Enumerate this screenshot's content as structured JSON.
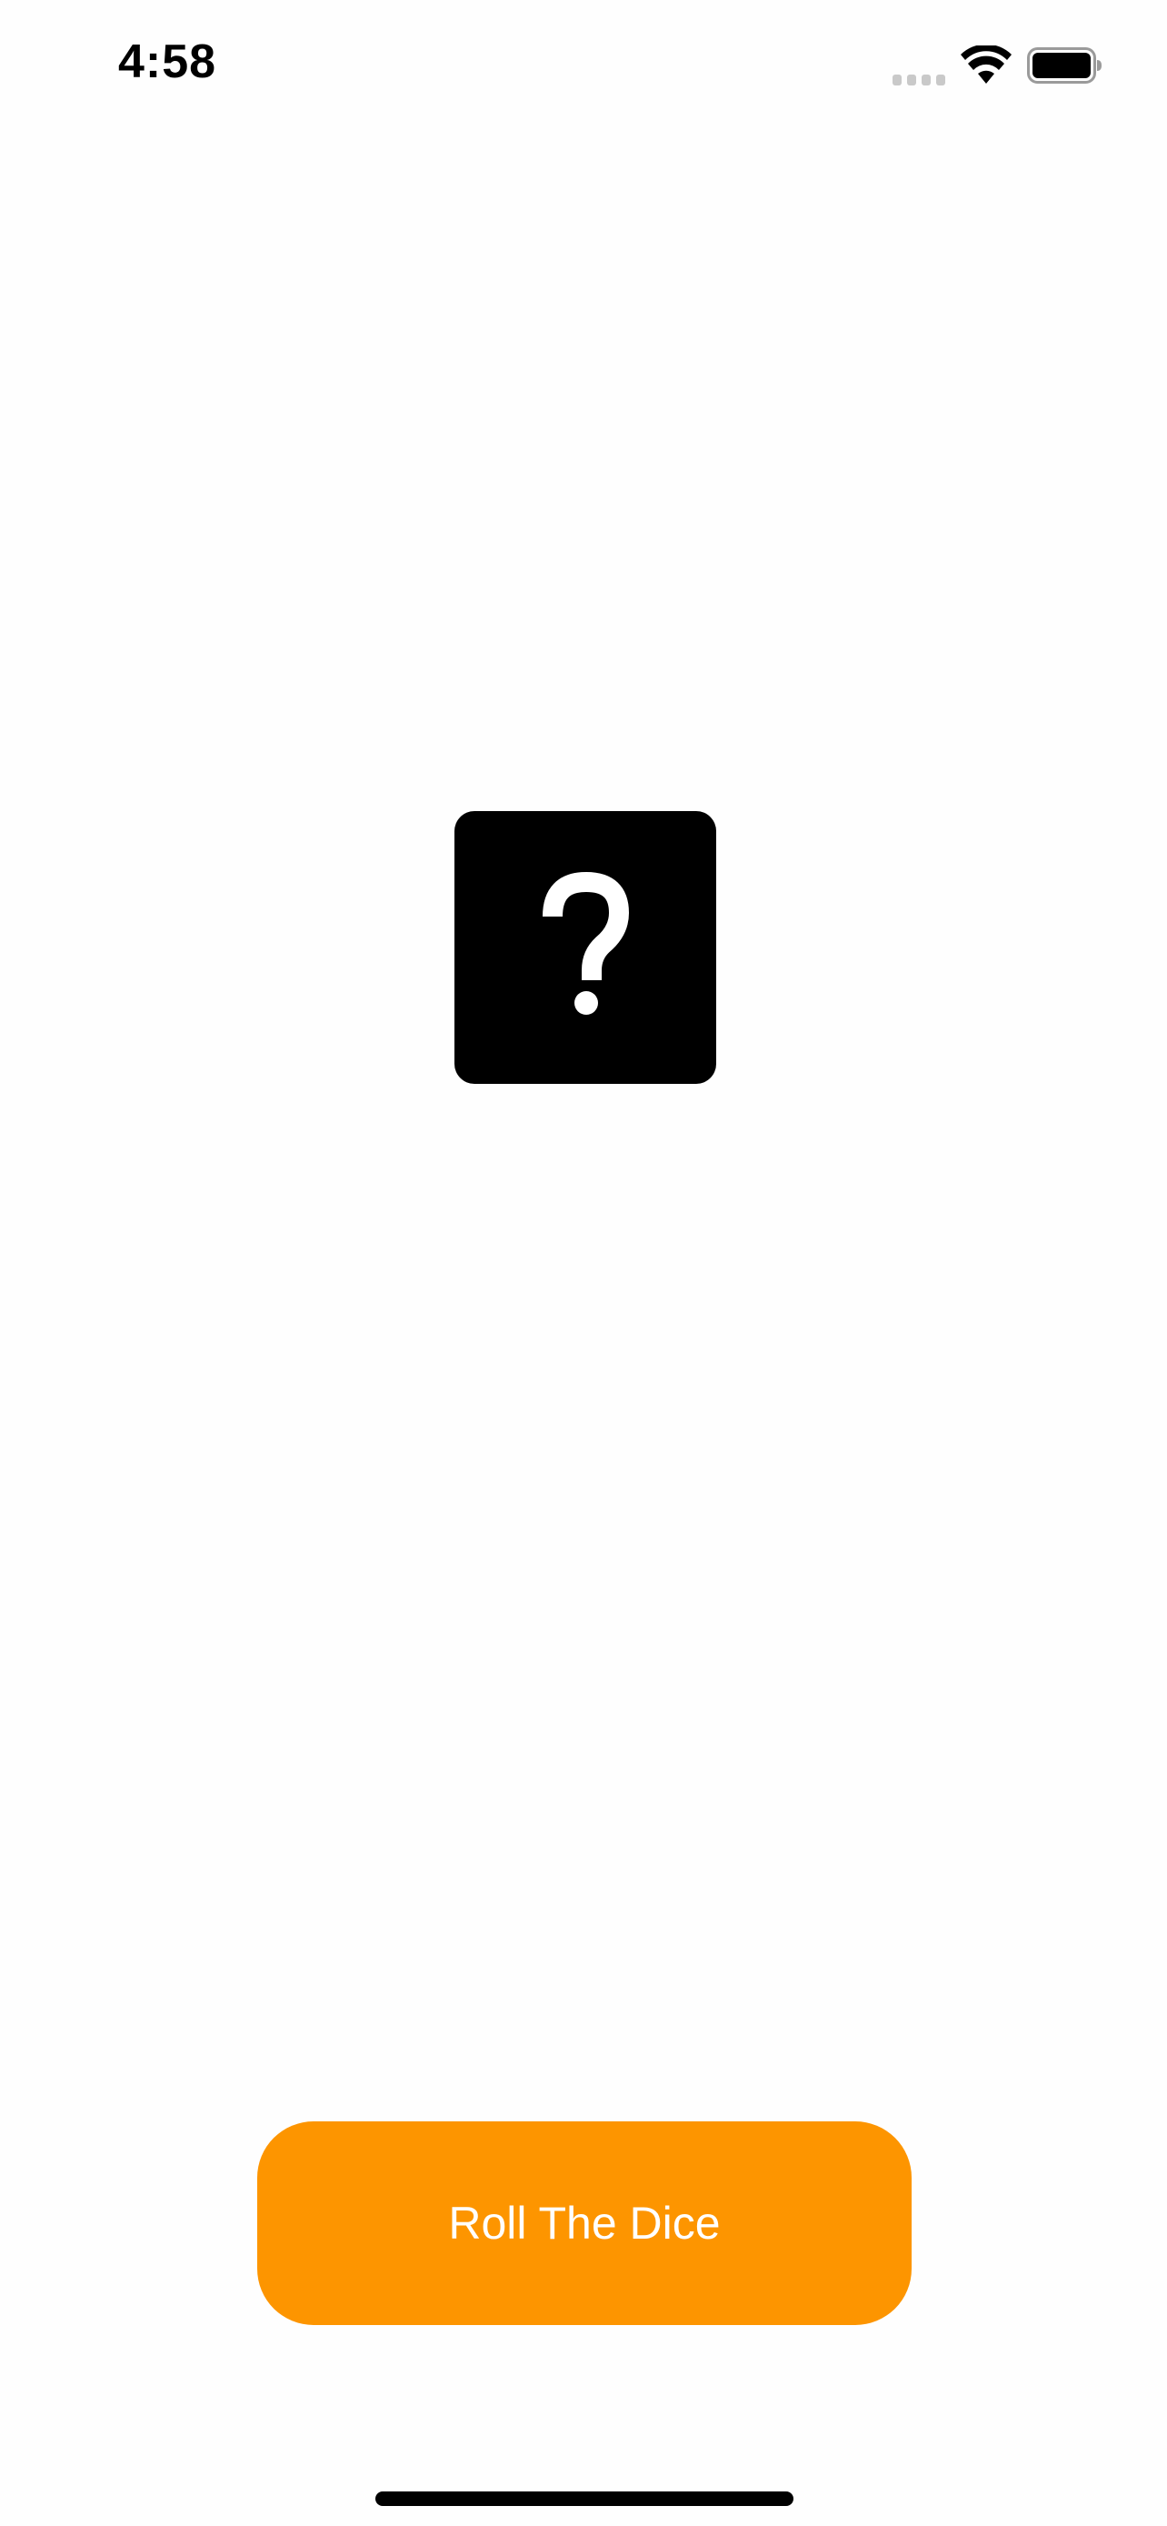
{
  "status_bar": {
    "time": "4:58",
    "signal_icon": "cellular-signal-icon",
    "wifi_icon": "wifi-icon",
    "battery_icon": "battery-icon"
  },
  "dice": {
    "icon": "question-mark-icon",
    "symbol": "?",
    "background_color": "#000000",
    "symbol_color": "#ffffff"
  },
  "actions": {
    "roll_label": "Roll The Dice",
    "roll_color": "#fd9500"
  },
  "home_indicator": {
    "icon": "home-indicator-bar"
  }
}
